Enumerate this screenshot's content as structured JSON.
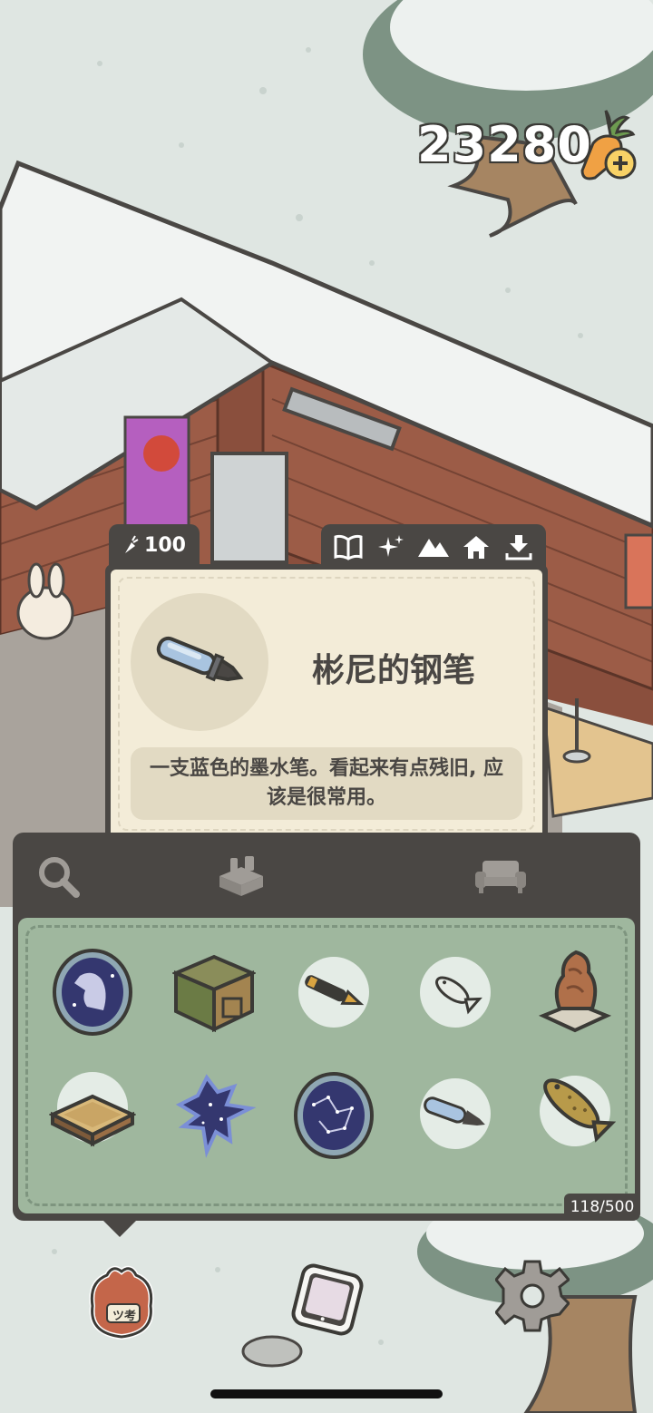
{
  "currency": {
    "amount": "23280",
    "icon": "carrot-add-icon"
  },
  "item": {
    "price": "100",
    "price_icon": "carrot-icon",
    "name": "彬尼的钢笔",
    "description": "一支蓝色的墨水笔。看起来有点残旧, 应该是很常用。",
    "icon": "fountain-pen-icon"
  },
  "category_tabs": [
    {
      "name": "book-icon"
    },
    {
      "name": "sparkle-icon"
    },
    {
      "name": "mountain-icon"
    },
    {
      "name": "house-icon"
    },
    {
      "name": "download-icon"
    }
  ],
  "bag": {
    "tabs": [
      {
        "name": "search-icon"
      },
      {
        "name": "gift-box-icon"
      },
      {
        "name": "sofa-icon"
      }
    ],
    "count": "118/500",
    "items": [
      {
        "name": "crow-badge-icon"
      },
      {
        "name": "wooden-box-icon"
      },
      {
        "name": "gold-pen-icon"
      },
      {
        "name": "small-fish-icon"
      },
      {
        "name": "rock-statue-icon"
      },
      {
        "name": "wooden-tray-icon"
      },
      {
        "name": "star-crow-icon"
      },
      {
        "name": "constellation-badge-icon"
      },
      {
        "name": "blue-pen-icon"
      },
      {
        "name": "big-fish-icon"
      }
    ]
  },
  "nav": [
    {
      "name": "bag-icon",
      "label": "ツ考"
    },
    {
      "name": "phone-icon"
    },
    {
      "name": "settings-gear-icon"
    }
  ],
  "colors": {
    "panel": "#4a4744",
    "card": "#f3ecd8",
    "grid": "#9fb79e",
    "snow": "#dfe6e2",
    "brick": "#8a4f3d"
  }
}
